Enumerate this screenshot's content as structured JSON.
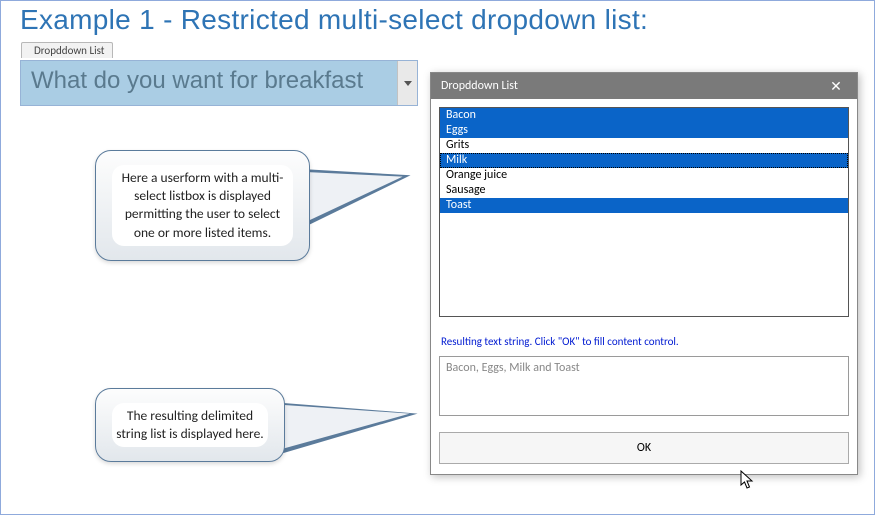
{
  "heading": "Example 1 - Restricted multi-select dropdown list:",
  "content_control": {
    "tab_label": "Dropddown List",
    "text": "What do you want for breakfast"
  },
  "callouts": {
    "listbox_note": "Here a userform with a multi-select listbox is displayed permitting the user to select one or more listed items.",
    "result_note": "The resulting delimited string list is displayed here."
  },
  "dialog": {
    "title": "Dropddown List",
    "close_glyph": "✕",
    "items": [
      {
        "label": "Bacon",
        "selected": true,
        "focused": false
      },
      {
        "label": "Eggs",
        "selected": true,
        "focused": false
      },
      {
        "label": "Grits",
        "selected": false,
        "focused": false
      },
      {
        "label": "Milk",
        "selected": true,
        "focused": true
      },
      {
        "label": "Orange juice",
        "selected": false,
        "focused": false
      },
      {
        "label": "Sausage",
        "selected": false,
        "focused": false
      },
      {
        "label": "Toast",
        "selected": true,
        "focused": false
      }
    ],
    "hint": "Resulting text string. Click \"OK\" to fill content control.",
    "result_text": "Bacon, Eggs, Milk and Toast",
    "ok_label": "OK"
  }
}
